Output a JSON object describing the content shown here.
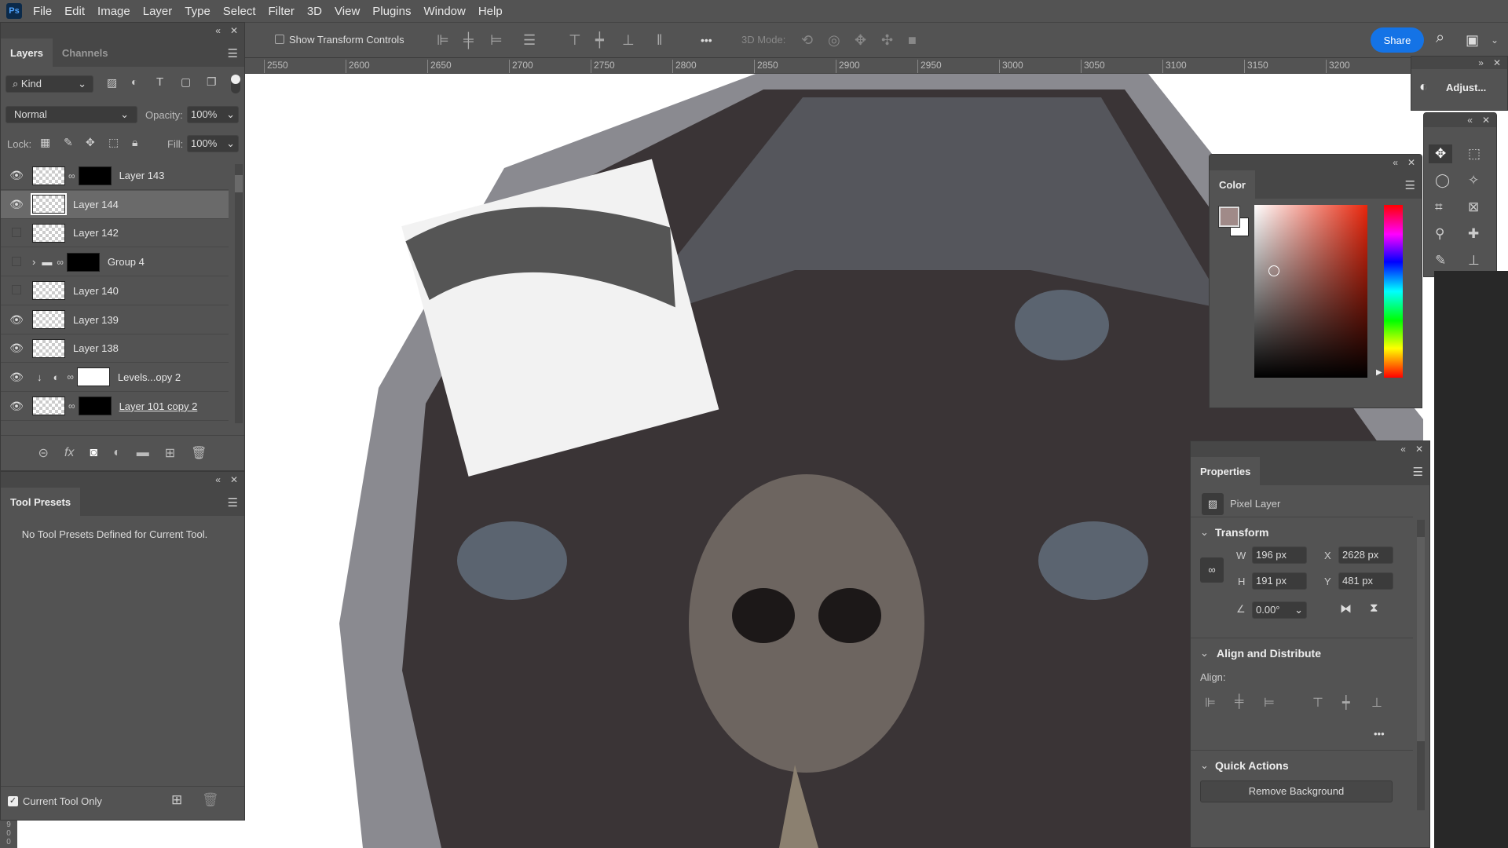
{
  "app": {
    "logo": "Ps"
  },
  "menu": [
    "File",
    "Edit",
    "Image",
    "Layer",
    "Type",
    "Select",
    "Filter",
    "3D",
    "View",
    "Plugins",
    "Window",
    "Help"
  ],
  "options": {
    "show_transform_controls": "Show Transform Controls",
    "show_transform_checked": false,
    "mode_3d": "3D Mode:",
    "more": "•••",
    "share": "Share"
  },
  "ruler": {
    "ticks": [
      "2550",
      "2600",
      "2650",
      "2700",
      "2750",
      "2800",
      "2850",
      "2900",
      "2950",
      "3000",
      "3050",
      "3100",
      "3150",
      "3200"
    ],
    "left_ticks": [
      "9",
      "0",
      "0"
    ]
  },
  "layers_panel": {
    "tabs": [
      "Layers",
      "Channels"
    ],
    "filter_kind": "Kind",
    "blend_mode": "Normal",
    "opacity_label": "Opacity:",
    "opacity": "100%",
    "lock_label": "Lock:",
    "fill_label": "Fill:",
    "fill": "100%",
    "layers": [
      {
        "name": "Layer 143",
        "visible": true,
        "mask": true,
        "selected": false
      },
      {
        "name": "Layer 144",
        "visible": true,
        "mask": false,
        "selected": true
      },
      {
        "name": "Layer 142",
        "visible": false,
        "mask": false,
        "selected": false
      },
      {
        "name": "Group 4",
        "visible": false,
        "mask": true,
        "group": true,
        "selected": false
      },
      {
        "name": "Layer 140",
        "visible": false,
        "mask": false,
        "selected": false
      },
      {
        "name": "Layer 139",
        "visible": true,
        "mask": false,
        "selected": false
      },
      {
        "name": "Layer 138",
        "visible": true,
        "mask": false,
        "selected": false
      },
      {
        "name": "Levels...opy 2",
        "visible": true,
        "mask": true,
        "adjustment": true,
        "selected": false
      },
      {
        "name": "Layer 101 copy 2",
        "visible": true,
        "mask": true,
        "selected": false
      }
    ]
  },
  "tool_presets": {
    "title": "Tool Presets",
    "empty": "No Tool Presets Defined for Current Tool.",
    "current_tool_only": "Current Tool Only",
    "current_tool_only_checked": true
  },
  "adjust_panel": {
    "label": "Adjust..."
  },
  "color_panel": {
    "title": "Color",
    "foreground": "#a08a88",
    "background": "#ffffff",
    "hue_color": "#e8260c"
  },
  "properties": {
    "title": "Properties",
    "kind": "Pixel Layer",
    "transform": "Transform",
    "w_label": "W",
    "w": "196 px",
    "h_label": "H",
    "h": "191 px",
    "x_label": "X",
    "x": "2628 px",
    "y_label": "Y",
    "y": "481 px",
    "angle": "0.00°",
    "align_distribute": "Align and Distribute",
    "align_label": "Align:",
    "more": "•••",
    "quick_actions": "Quick Actions",
    "remove_bg": "Remove Background"
  },
  "colors": {
    "accent": "#1473e6",
    "panel": "#535353"
  }
}
